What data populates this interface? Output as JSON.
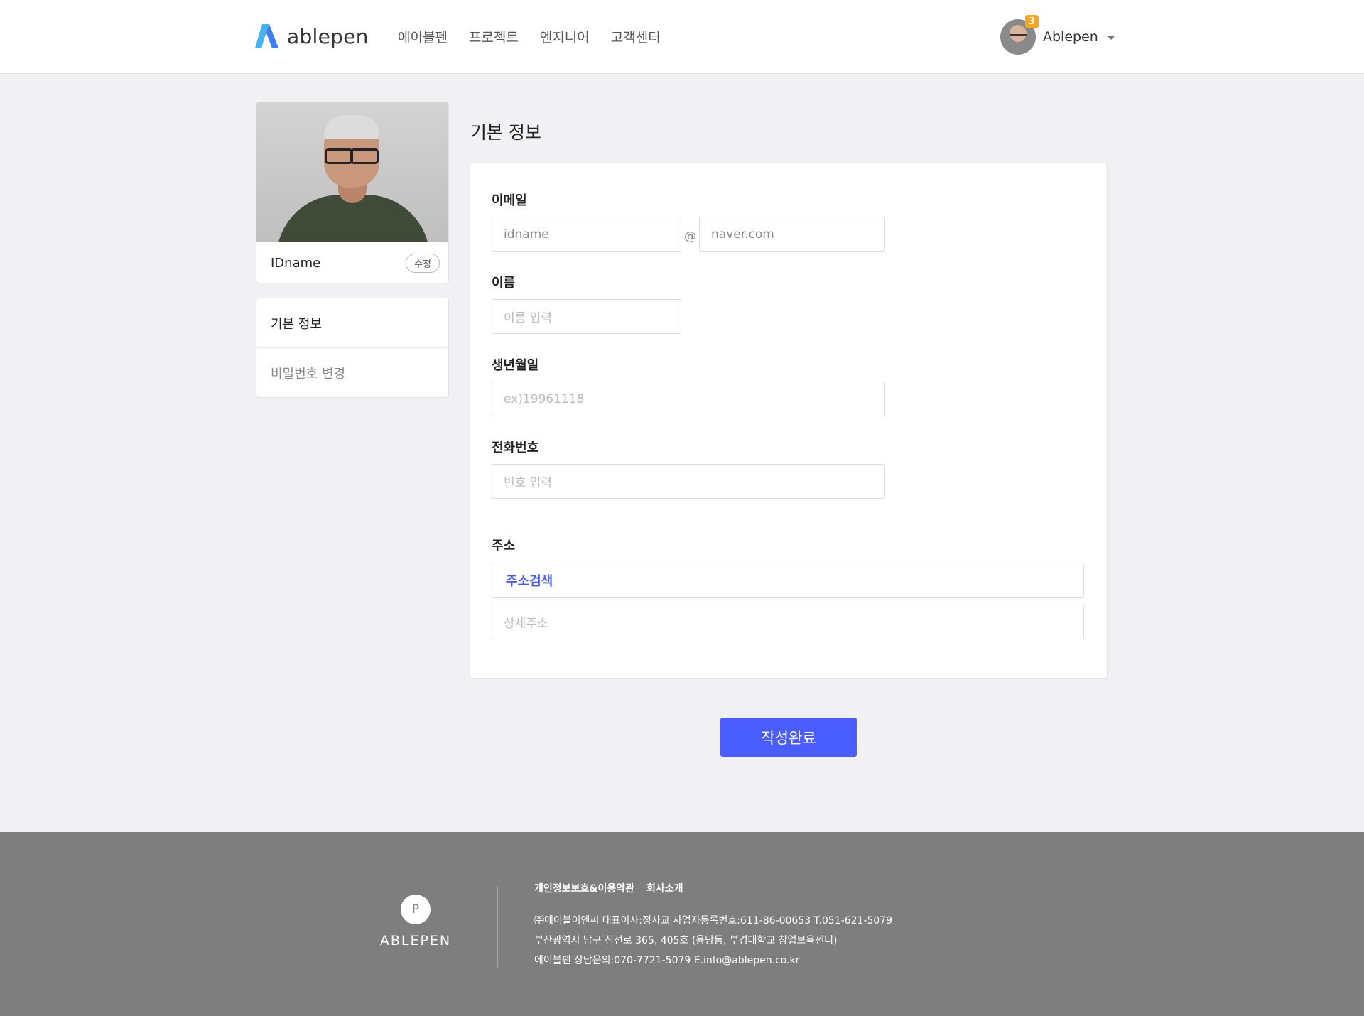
{
  "header": {
    "brand": "ablepen",
    "nav": [
      "에이블펜",
      "프로젝트",
      "엔지니어",
      "고객센터"
    ],
    "user": {
      "name": "Ablepen",
      "badge_count": "3"
    }
  },
  "sidebar": {
    "profile_id": "IDname",
    "edit_label": "수정",
    "menu": [
      "기본 정보",
      "비밀번호 변경"
    ]
  },
  "main": {
    "section_title": "기본 정보",
    "email": {
      "label": "이메일",
      "id_value": "idname",
      "at": "@",
      "domain_value": "naver.com"
    },
    "name": {
      "label": "이름",
      "placeholder": "이름 입력"
    },
    "birth": {
      "label": "생년월일",
      "placeholder": "ex)19961118"
    },
    "phone": {
      "label": "전화번호",
      "placeholder": "번호 입력"
    },
    "address": {
      "label": "주소",
      "search_label": "주소검색",
      "detail_placeholder": "상세주소"
    },
    "submit_label": "작성완료"
  },
  "footer": {
    "logo_letter": "P",
    "brand": "ABLEPEN",
    "links": [
      "개인정보보호&이용약관",
      "회사소개"
    ],
    "info_lines": [
      "㈜에이블이엔씨   대표이사:정사교   사업자등록번호:611-86-00653   T.051-621-5079",
      "부산광역시 남구 신선로 365, 405호 (용당동, 부경대학교 창업보육센터)",
      "에이블펜 상담문의:070-7721-5079   E.info@ablepen.co.kr"
    ]
  },
  "colors": {
    "accent": "#4a5eff",
    "badge": "#f5a623",
    "footer_bg": "#7e7e7e",
    "page_bg": "#f1f1f3"
  }
}
